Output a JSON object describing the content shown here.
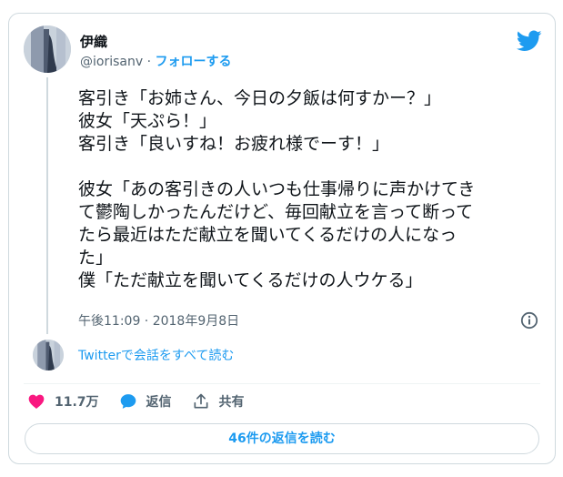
{
  "author": {
    "name": "伊織",
    "handle": "@iorisanv",
    "separator": "·",
    "follow_label": "フォローする"
  },
  "tweet": {
    "lines": [
      "客引き「お姉さん、今日の夕飯は何すかー？」",
      "彼女「天ぷら！」",
      "客引き「良いすね！お疲れ様でーす！」",
      "",
      "彼女「あの客引きの人いつも仕事帰りに声かけてき",
      "て鬱陶しかったんだけど、毎回献立を言って断って",
      "たら最近はただ献立を聞いてくるだけの人になっ",
      "た」",
      "僕「ただ献立を聞いてくるだけの人ウケる」"
    ],
    "timestamp": "午後11:09 · 2018年9月8日"
  },
  "conversation": {
    "link_label": "Twitterで会話をすべて読む"
  },
  "actions": {
    "like_count": "11.7万",
    "reply_label": "返信",
    "share_label": "共有"
  },
  "replies_button": {
    "label": "46件の返信を読む"
  },
  "icons": {
    "brand": "twitter-bird-icon",
    "info": "info-icon",
    "like": "heart-icon",
    "reply": "speech-bubble-icon",
    "share": "share-icon"
  },
  "colors": {
    "accent": "#1d9bf0",
    "like": "#f91880",
    "text": "#0f1419",
    "muted": "#536471",
    "border": "#cfd9de"
  }
}
